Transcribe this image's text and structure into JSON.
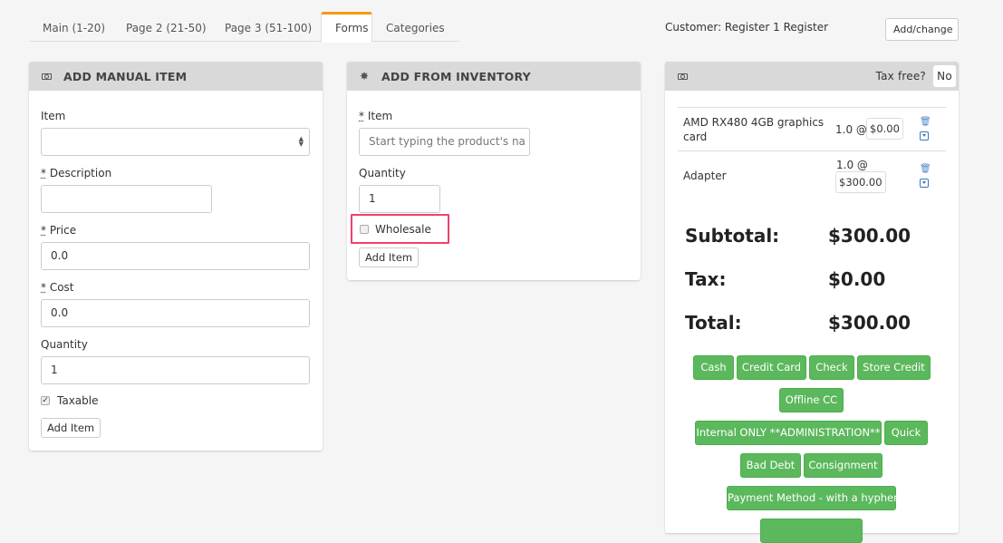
{
  "tabs": [
    {
      "label": "Main (1-20)",
      "active": false
    },
    {
      "label": "Page 2 (21-50)",
      "active": false
    },
    {
      "label": "Page 3 (51-100)",
      "active": false
    },
    {
      "label": "Forms",
      "active": true
    },
    {
      "label": "Categories",
      "active": false
    }
  ],
  "customer": {
    "text": "Customer: Register 1 Register",
    "add_change_label": "Add/change"
  },
  "manual_item": {
    "title": "ADD MANUAL ITEM",
    "icon": "money-icon",
    "item_label": "Item",
    "item_value": "",
    "required_marker": "*",
    "description_label": "Description",
    "description_value": "",
    "price_label": "Price",
    "price_value": "0.0",
    "cost_label": "Cost",
    "cost_value": "0.0",
    "quantity_label": "Quantity",
    "quantity_value": "1",
    "taxable_label": "Taxable",
    "taxable_checked": true,
    "add_item_label": "Add Item"
  },
  "inventory": {
    "title": "ADD FROM INVENTORY",
    "icon": "gear-icon",
    "required_marker": "*",
    "item_label": "Item",
    "item_placeholder": "Start typing the product's na",
    "quantity_label": "Quantity",
    "quantity_value": "1",
    "wholesale_label": "Wholesale",
    "wholesale_checked": false,
    "add_item_label": "Add Item"
  },
  "cart": {
    "icon": "money-icon",
    "tax_free_label": "Tax free?",
    "tax_free_value": "No",
    "items": [
      {
        "name_line1": "AMD RX480 4GB graphics",
        "name_line2": "card",
        "qty": "1.0 @",
        "price": "$0.00"
      },
      {
        "name_line1": "Adapter",
        "name_line2": "",
        "qty": "1.0 @",
        "price": "$300.00"
      }
    ],
    "subtotal_label": "Subtotal:",
    "subtotal_value": "$300.00",
    "tax_label": "Tax:",
    "tax_value": "$0.00",
    "total_label": "Total:",
    "total_value": "$300.00",
    "payment_methods": [
      "Cash",
      "Credit Card",
      "Check",
      "Store Credit",
      "Offline CC",
      "Internal ONLY **ADMINISTRATION**",
      "Quick",
      "Bad Debt",
      "Consignment",
      "Payment Method - with a hyphen",
      ""
    ]
  },
  "colors": {
    "accent_tab": "#f39c12",
    "payment_green": "#5cb85c",
    "highlight_pink": "#f0406e",
    "icon_blue": "#3a76b5"
  }
}
